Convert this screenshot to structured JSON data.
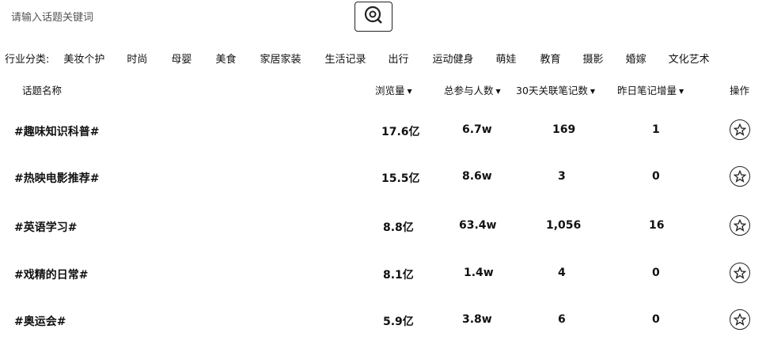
{
  "search": {
    "placeholder": "请输入话题关键词"
  },
  "categories": {
    "label": "行业分类:",
    "items": [
      "美妆个护",
      "时尚",
      "母婴",
      "美食",
      "家居家装",
      "生活记录",
      "出行",
      "运动健身",
      "萌娃",
      "教育",
      "摄影",
      "婚嫁",
      "文化艺术"
    ]
  },
  "table": {
    "headers": {
      "name": "话题名称",
      "views": "浏览量",
      "participants": "总参与人数",
      "notes30": "30天关联笔记数",
      "yesterday": "昨日笔记增量",
      "action": "操作"
    },
    "rows": [
      {
        "name": "#趣味知识科普#",
        "views": "17.6亿",
        "participants": "6.7w",
        "notes30": "169",
        "yesterday": "1"
      },
      {
        "name": "#热映电影推荐#",
        "views": "15.5亿",
        "participants": "8.6w",
        "notes30": "3",
        "yesterday": "0"
      },
      {
        "name": "#英语学习#",
        "views": "8.8亿",
        "participants": "63.4w",
        "notes30": "1,056",
        "yesterday": "16"
      },
      {
        "name": "#戏精的日常#",
        "views": "8.1亿",
        "participants": "1.4w",
        "notes30": "4",
        "yesterday": "0"
      },
      {
        "name": "#奥运会#",
        "views": "5.9亿",
        "participants": "3.8w",
        "notes30": "6",
        "yesterday": "0"
      }
    ]
  },
  "icons": {
    "search": "search-icon",
    "sort": "caret-down-icon",
    "favorite": "star-icon"
  }
}
